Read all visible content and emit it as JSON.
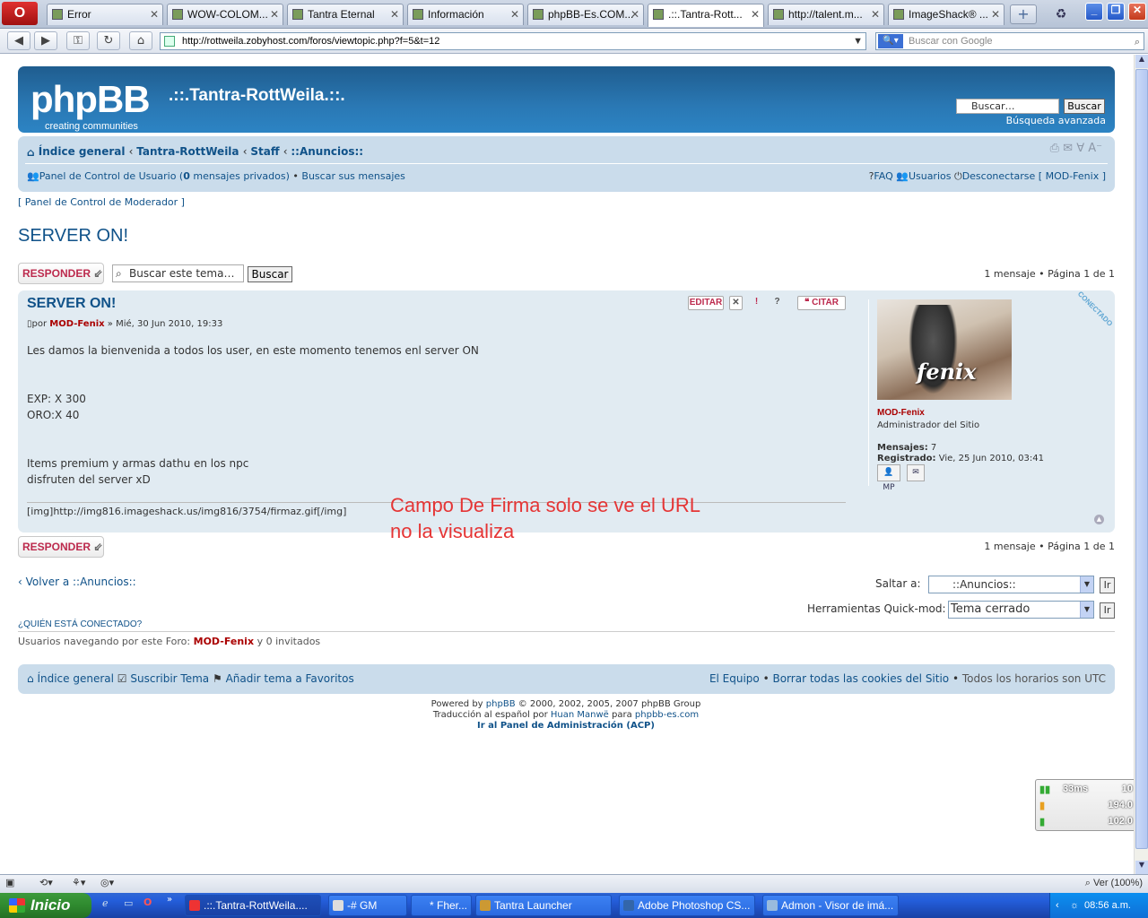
{
  "browser": {
    "tabs": [
      {
        "label": "Error"
      },
      {
        "label": "WOW-COLOM..."
      },
      {
        "label": "Tantra Eternal"
      },
      {
        "label": "Información"
      },
      {
        "label": "phpBB-Es.COM..."
      },
      {
        "label": ".::.Tantra-Rott..."
      },
      {
        "label": "http://talent.m..."
      },
      {
        "label": "ImageShack® ..."
      }
    ],
    "url": "http://rottweila.zobyhost.com/foros/viewtopic.php?f=5&t=12",
    "search_placeholder": "Buscar con Google"
  },
  "header": {
    "logo_text": "phpBB",
    "logo_tagline": "creating communities",
    "site_name": ".::.Tantra-RottWeila.::.",
    "search_placeholder": "Buscar…",
    "search_button": "Buscar",
    "advanced_search": "Búsqueda avanzada"
  },
  "breadcrumbs": [
    "Índice general",
    "Tantra-RottWeila",
    "Staff",
    "::Anuncios::"
  ],
  "navbar": {
    "ucp_label": "Panel de Control de Usuario (",
    "pm_count": "0",
    "pm_suffix": " mensajes privados)",
    "search_own": "Buscar sus mensajes",
    "faq": "FAQ",
    "users": "Usuarios",
    "logout": "Desconectarse [ MOD-Fenix ]"
  },
  "mod_panel_link": "[ Panel de Control de Moderador ]",
  "topic": {
    "title": "SERVER ON!",
    "reply_label": "RESPONDER",
    "search_placeholder": "Buscar este tema…",
    "search_button": "Buscar",
    "pagination": "1 mensaje • Página 1 de 1"
  },
  "post": {
    "title": "SERVER ON!",
    "by": "por",
    "author": "MOD-Fenix",
    "date": "» Mié, 30 Jun 2010, 19:33",
    "buttons": {
      "edit": "EDITAR",
      "quote": "CITAR"
    },
    "body": {
      "line1": "Les damos la bienvenida a todos los user, en este momento tenemos enl server ON",
      "line2": "EXP: X 300",
      "line3": "ORO:X 40",
      "line4": "Items premium y armas dathu en los npc",
      "line5": "disfruten del server xD"
    },
    "signature": "[img]http://img816.imageshack.us/img816/3754/firmaz.gif[/img]",
    "online_badge": "CONECTADO"
  },
  "profile": {
    "avatar_text": "fenix",
    "name": "MOD-Fenix",
    "rank": "Administrador del Sitio",
    "posts_label": "Mensajes:",
    "posts": "7",
    "registered_label": "Registrado:",
    "registered": "Vie, 25 Jun 2010, 03:41",
    "pm_icon_label": "MP"
  },
  "annotation": "Campo  De Firma solo se ve el URL no la visualiza",
  "bottom": {
    "back_link": "Volver a ::Anuncios::",
    "jump_label": "Saltar a:",
    "jump_value": "::Anuncios::",
    "go_label": "Ir",
    "quickmod_label": "Herramientas Quick-mod:",
    "quickmod_value": "Tema cerrado",
    "who_heading": "¿QUIÉN ESTÁ CONECTADO?",
    "who_prefix": "Usuarios navegando por este Foro:",
    "who_user": "MOD-Fenix",
    "who_suffix": "y 0 invitados"
  },
  "footer_nav": {
    "index": "Índice general",
    "subscribe": "Suscribir Tema",
    "bookmark": "Añadir tema a Favoritos",
    "team": "El Equipo",
    "cookies": "Borrar todas las cookies del Sitio",
    "tz": "Todos los horarios son UTC"
  },
  "copyright": {
    "line1_prefix": "Powered by",
    "line1_link": "phpBB",
    "line1_suffix": "© 2000, 2002, 2005, 2007 phpBB Group",
    "line2_prefix": "Traducción al español por",
    "line2_person": "Huan Manwë",
    "line2_mid": "para",
    "line2_site": "phpbb-es.com",
    "line3": "Ir al Panel de Administración (ACP)"
  },
  "netmon": {
    "ping": "33ms",
    "count": "10",
    "down": "194.0",
    "up": "102.0"
  },
  "statusbar": {
    "zoom": "Ver (100%)"
  },
  "taskbar": {
    "start": "Inicio",
    "buttons": [
      {
        "label": ".::.Tantra-RottWeila...."
      },
      {
        "label": "-#   GM"
      },
      {
        "label": "* Fher..."
      },
      {
        "label": "Tantra Launcher"
      },
      {
        "label": "Adobe Photoshop CS..."
      },
      {
        "label": "Admon - Visor de imá..."
      }
    ],
    "clock": "08:56 a.m."
  }
}
